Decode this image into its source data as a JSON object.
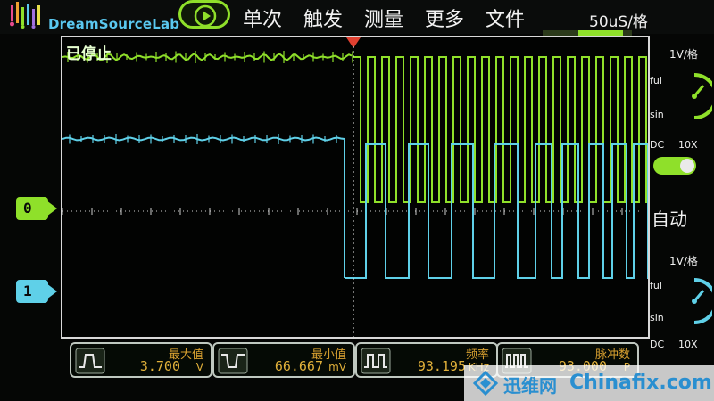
{
  "header": {
    "logo_text": "DreamSourceLab",
    "menu": [
      "单次",
      "触发",
      "测量",
      "更多",
      "文件"
    ],
    "timebase": "50uS/格"
  },
  "screen": {
    "status": "已停止"
  },
  "channels": [
    {
      "marker": "0",
      "color": "#8fe02a",
      "volts_per_div": "1V/格",
      "mode_top": "ful",
      "mode_bottom": "sin",
      "coupling": "DC",
      "probe": "10X"
    },
    {
      "marker": "1",
      "color": "#5fd0e8",
      "volts_per_div": "1V/格",
      "mode_top": "ful",
      "mode_bottom": "sin",
      "coupling": "DC",
      "probe": "10X"
    }
  ],
  "right_panel": {
    "trigger_mode": "自动"
  },
  "measurements": [
    {
      "label": "最大值",
      "value": "3.700",
      "unit": "V",
      "icon": "max-waveform-icon"
    },
    {
      "label": "最小值",
      "value": "66.667",
      "unit": "mV",
      "icon": "min-waveform-icon"
    },
    {
      "label": "频率",
      "value": "93.195",
      "unit": "KHz",
      "icon": "frequency-waveform-icon"
    },
    {
      "label": "脉冲数",
      "value": "93.000",
      "unit": "P",
      "icon": "pulse-count-icon"
    }
  ],
  "watermark": {
    "cn": "迅维网",
    "en": "Chinafix.com"
  },
  "colors": {
    "ch0": "#8fe02a",
    "ch1": "#5fd0e8",
    "accent": "#8fe02a",
    "measure_text": "#e0b03a",
    "trigger_marker": "#e04030"
  }
}
